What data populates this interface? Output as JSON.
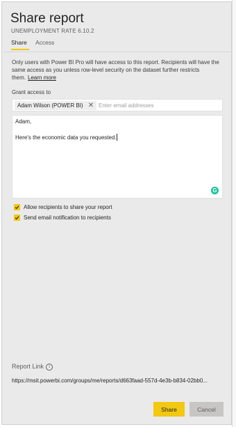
{
  "dialog": {
    "title": "Share report",
    "subtitle": "UNEMPLOYMENT RATE 6.10.2"
  },
  "tabs": [
    {
      "label": "Share",
      "active": true
    },
    {
      "label": "Access",
      "active": false
    }
  ],
  "info": {
    "text": "Only users with Power BI Pro will have access to this report. Recipients will have the same access as you unless row-level security on the dataset further restricts them.",
    "learn_more": "Learn more"
  },
  "grant": {
    "label": "Grant access to",
    "recipient_chip": "Adam Wilson (POWER BI)",
    "remove_glyph": "✕",
    "placeholder": "Enter email addresses"
  },
  "message": {
    "greeting": "Adam,",
    "body": "Here's the economic data you requested."
  },
  "grammarly_glyph": "G",
  "options": [
    {
      "label": "Allow recipients to share your report",
      "checked": true
    },
    {
      "label": "Send email notification to recipients",
      "checked": true
    }
  ],
  "report_link": {
    "label": "Report Link",
    "info_glyph": "i",
    "url": "https://msit.powerbi.com/groups/me/reports/d663faad-557d-4e3b-b834-02bb0..."
  },
  "buttons": {
    "share": "Share",
    "cancel": "Cancel"
  },
  "colors": {
    "accent": "#f2c811",
    "panel_bg": "#eaeaea",
    "cancel_bg": "#c8c6c4",
    "grammarly": "#15c39a"
  }
}
